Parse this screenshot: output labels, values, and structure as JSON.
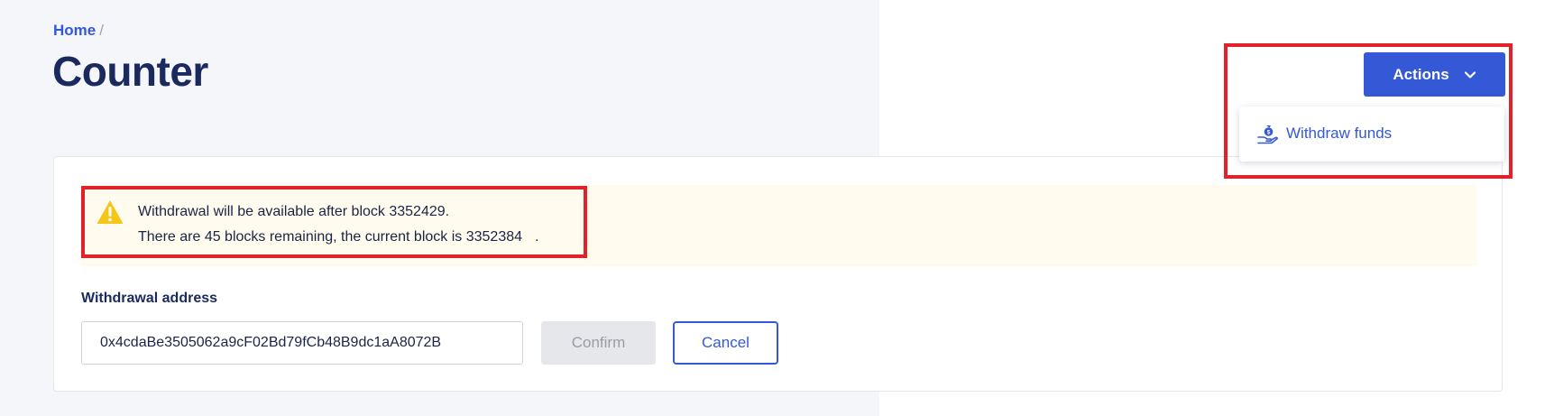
{
  "breadcrumb": {
    "home": "Home",
    "separator": "/"
  },
  "page": {
    "title": "Counter"
  },
  "actions": {
    "button_label": "Actions",
    "chevron_icon": "chevron-down-icon",
    "menu": [
      {
        "label": "Withdraw funds",
        "icon": "money-bag-hand-icon"
      }
    ]
  },
  "alert": {
    "icon": "warning-icon",
    "line1": "Withdrawal will be available after block 3352429.",
    "line2_prefix": "There are 45 blocks remaining, the current block is",
    "current_block": "3352384",
    "line2_suffix": "."
  },
  "withdrawal": {
    "label": "Withdrawal address",
    "address": "0x4cdaBe3505062a9cF02Bd79fCb48B9dc1aA8072B",
    "confirm_label": "Confirm",
    "cancel_label": "Cancel"
  },
  "colors": {
    "accent": "#3558d6",
    "title": "#1b2a5e",
    "alert_bg": "#fffbee",
    "warning": "#f5c518",
    "highlight": "#e3212b"
  }
}
